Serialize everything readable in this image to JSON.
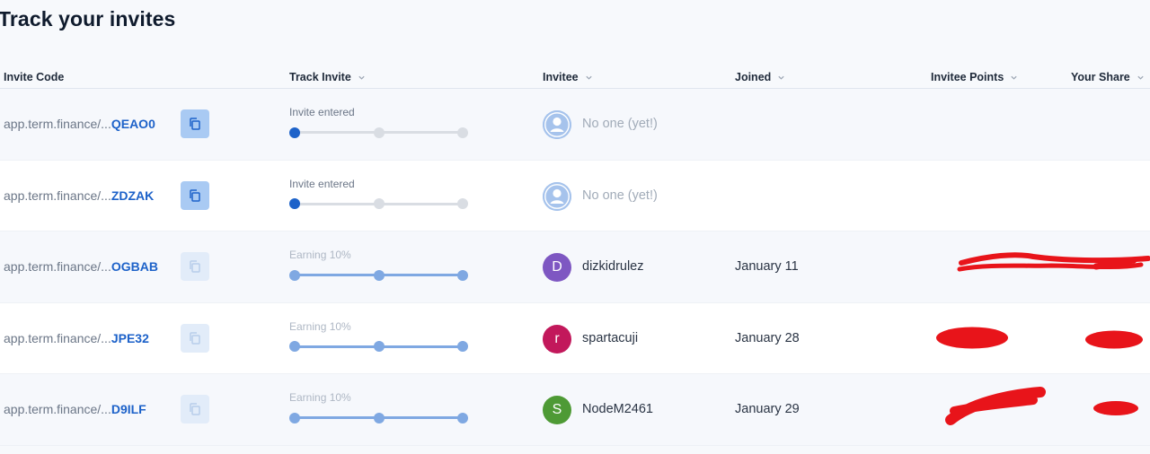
{
  "page": {
    "title": "Track your invites"
  },
  "table": {
    "columns": [
      {
        "label": "Invite Code",
        "sortable": false
      },
      {
        "label": "Track Invite",
        "sortable": true
      },
      {
        "label": "Invitee",
        "sortable": true
      },
      {
        "label": "Joined",
        "sortable": true
      },
      {
        "label": "Invitee Points",
        "sortable": true
      },
      {
        "label": "Your Share",
        "sortable": true
      }
    ],
    "rows": [
      {
        "code_prefix": "app.term.finance/...",
        "code_suffix": "QEAO0",
        "copy_enabled": true,
        "track_label": "Invite entered",
        "track_progress": 0,
        "invitee": "No one (yet!)",
        "invitee_initial": "",
        "joined": "",
        "redacted": false
      },
      {
        "code_prefix": "app.term.finance/...",
        "code_suffix": "ZDZAK",
        "copy_enabled": true,
        "track_label": "Invite entered",
        "track_progress": 0,
        "invitee": "No one (yet!)",
        "invitee_initial": "",
        "joined": "",
        "redacted": false
      },
      {
        "code_prefix": "app.term.finance/...",
        "code_suffix": "OGBAB",
        "copy_enabled": false,
        "track_label": "Earning 10%",
        "track_progress": 2,
        "invitee": "dizkidrulez",
        "invitee_initial": "D",
        "joined": "January 11",
        "redacted": true
      },
      {
        "code_prefix": "app.term.finance/...",
        "code_suffix": "JPE32",
        "copy_enabled": false,
        "track_label": "Earning 10%",
        "track_progress": 2,
        "invitee": "spartacuji",
        "invitee_initial": "r",
        "joined": "January 28",
        "redacted": true
      },
      {
        "code_prefix": "app.term.finance/...",
        "code_suffix": "D9ILF",
        "copy_enabled": false,
        "track_label": "Earning 10%",
        "track_progress": 2,
        "invitee": "NodeM2461",
        "invitee_initial": "S",
        "joined": "January 29",
        "redacted": true
      }
    ]
  },
  "colors": {
    "accent": "#1d62c9",
    "track_done": "#7fa8e2",
    "track_empty": "#d9dde3",
    "redaction": "#e8141a",
    "avatar_row3": "#7e57c2",
    "avatar_row4": "#c2185b",
    "avatar_row5": "#4e9a35",
    "avatar_empty": "#a6c3ec"
  },
  "icons": {
    "copy": "copy-icon",
    "sort": "chevron-down-icon",
    "empty_user": "user-icon"
  }
}
